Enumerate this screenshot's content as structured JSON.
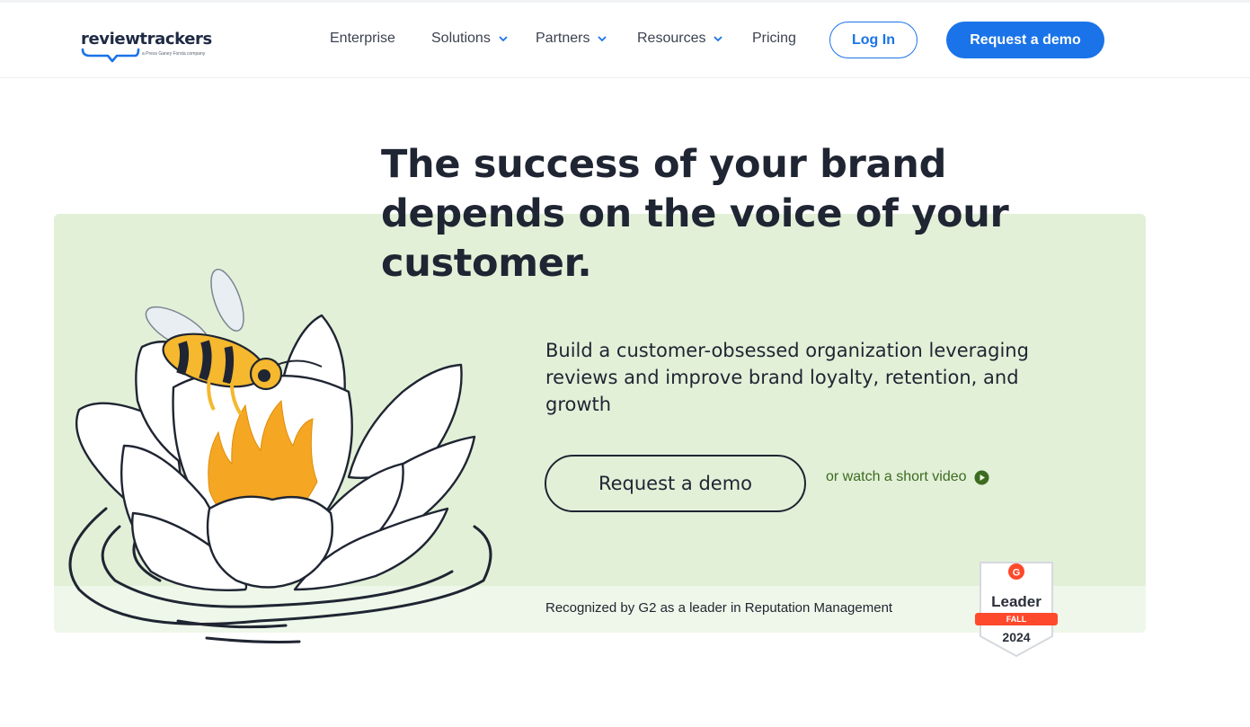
{
  "header": {
    "logo_text": "reviewtrackers",
    "logo_tagline": "a Press Ganey Forsta company",
    "nav": [
      {
        "label": "Enterprise",
        "has_dropdown": false
      },
      {
        "label": "Solutions",
        "has_dropdown": true
      },
      {
        "label": "Partners",
        "has_dropdown": true
      },
      {
        "label": "Resources",
        "has_dropdown": true
      },
      {
        "label": "Pricing",
        "has_dropdown": false
      }
    ],
    "login_label": "Log In",
    "demo_label": "Request a demo"
  },
  "hero": {
    "headline": "The success of your brand depends on the voice of your customer.",
    "subheadline": "Build a customer-obsessed organization leveraging reviews and improve brand loyalty, retention, and growth",
    "demo_button_label": "Request a demo",
    "video_link_label": "or watch a short video",
    "recognized_text": "Recognized by G2 as a leader in Reputation Management",
    "illustration_icon": "bee-on-water-lily-illustration"
  },
  "badge": {
    "logo_letter": "G",
    "title": "Leader",
    "season": "FALL",
    "year": "2024"
  },
  "colors": {
    "accent_blue": "#1a73e8",
    "hero_green": "#e2f0d8",
    "video_link_green": "#3d6b1f",
    "text_dark": "#1f2532",
    "badge_red": "#ff492c"
  }
}
